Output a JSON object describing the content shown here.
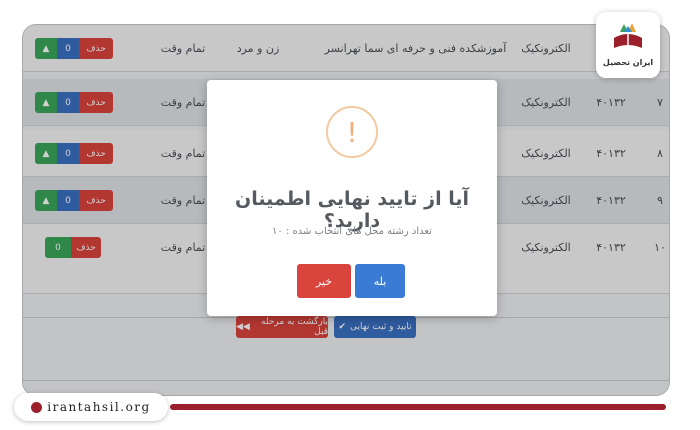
{
  "table": {
    "rows": [
      {
        "index": "",
        "code": "",
        "field": "الکترونکیک",
        "school": "آموزشکده فنی و حرفه ای سما تهرانسر",
        "gender": "زن و مرد",
        "time": "تمام وقت",
        "delete_label": "حذف",
        "count": "0"
      },
      {
        "index": "۷",
        "code": "۴۰۱۳۲",
        "field": "الکترونکیک",
        "school": "",
        "gender": "",
        "time": "تمام وقت",
        "delete_label": "حذف",
        "count": "0"
      },
      {
        "index": "۸",
        "code": "۴۰۱۳۲",
        "field": "الکترونکیک",
        "school": "",
        "gender": "",
        "time": "تمام وقت",
        "delete_label": "حذف",
        "count": "0"
      },
      {
        "index": "۹",
        "code": "۴۰۱۳۲",
        "field": "الکترونکیک",
        "school": "",
        "gender": "",
        "time": "تمام وقت",
        "delete_label": "حذف",
        "count": "0"
      },
      {
        "index": "۱۰",
        "code": "۴۰۱۳۲",
        "field": "الکترونکیک",
        "school": "",
        "gender": "",
        "time": "تمام وقت",
        "delete_label": "حذف",
        "count": "0"
      }
    ]
  },
  "footer_buttons": {
    "confirm_label": "تایید و ثبت نهایی",
    "confirm_icon": "check-icon",
    "back_label": "بازگشت به مرحله قبل",
    "back_icon": "double-arrow-icon"
  },
  "modal": {
    "icon": "exclamation-icon",
    "mark": "!",
    "title": "آیا از تایید نهایی اطمینان دارید؟",
    "subtitle": "تعداد رشته محل های انتخاب شده : ۱۰",
    "yes_label": "بله",
    "no_label": "خیر"
  },
  "branding": {
    "logo_text": "ایران تحصیل",
    "site": "irantahsil.org"
  },
  "colors": {
    "primary_blue": "#3a7bd5",
    "danger_red": "#d9443c",
    "success_green": "#3aa55a",
    "brand_maroon": "#9c1f2c",
    "warning_orange": "#f0b07a"
  }
}
